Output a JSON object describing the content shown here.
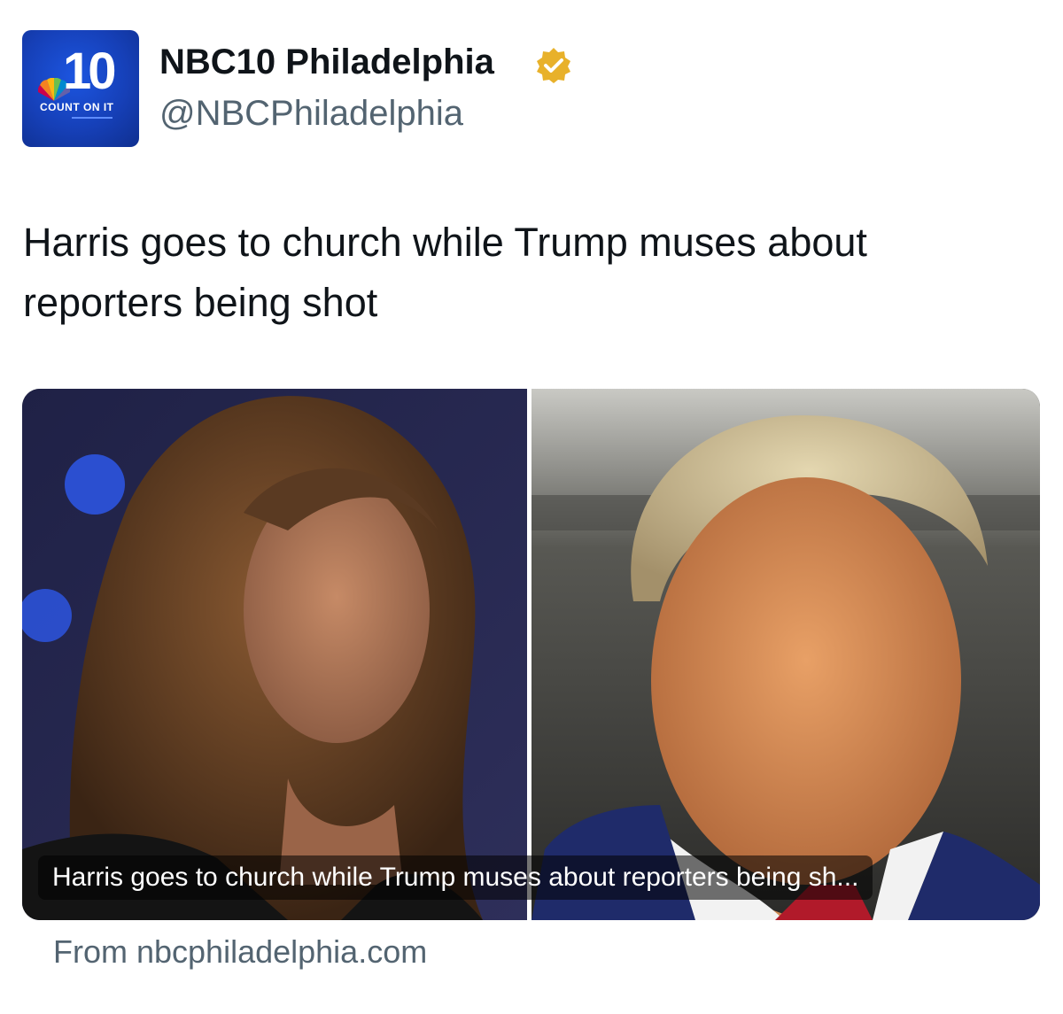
{
  "account": {
    "display_name": "NBC10 Philadelphia",
    "handle": "@NBCPhiladelphia",
    "verified": true,
    "verified_badge_color": "#e8b12a",
    "avatar": {
      "number": "10",
      "tagline": "COUNT ON IT",
      "background_color": "#1745c8"
    }
  },
  "tweet": {
    "text": "Harris goes to church while Trump muses about reporters being shot"
  },
  "link_card": {
    "caption": "Harris goes to church while Trump muses about reporters being sh...",
    "source": "From nbcphiladelphia.com",
    "image_left_desc_icon": "harris-photo",
    "image_right_desc_icon": "trump-photo"
  },
  "colors": {
    "text_primary": "#0f1419",
    "text_secondary": "#536471"
  }
}
